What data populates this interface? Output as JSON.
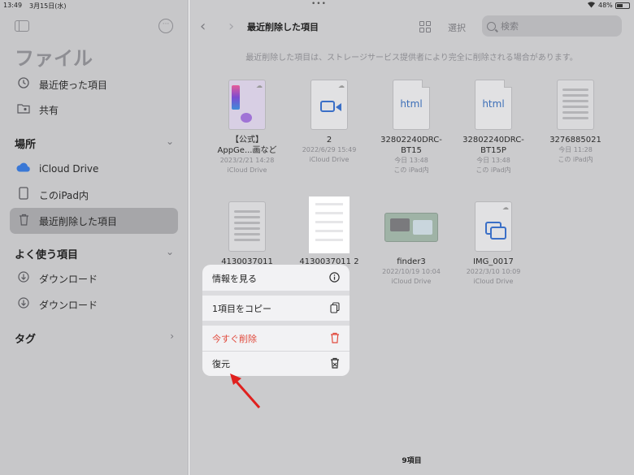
{
  "status": {
    "time": "13:49",
    "date": "3月15日(水)",
    "battery": "48%"
  },
  "sidebar": {
    "title": "ファイル",
    "items_top": [
      {
        "label": "最近使った項目",
        "icon": "clock-icon"
      },
      {
        "label": "共有",
        "icon": "shared-folder-icon"
      }
    ],
    "sections": [
      {
        "title": "場所",
        "items": [
          {
            "label": "iCloud Drive",
            "icon": "cloud-icon"
          },
          {
            "label": "このiPad内",
            "icon": "ipad-icon"
          },
          {
            "label": "最近削除した項目",
            "icon": "trash-icon",
            "selected": true
          }
        ]
      },
      {
        "title": "よく使う項目",
        "items": [
          {
            "label": "ダウンロード",
            "icon": "download-icon"
          },
          {
            "label": "ダウンロード",
            "icon": "download-icon"
          }
        ]
      },
      {
        "title": "タグ",
        "items": []
      }
    ]
  },
  "header": {
    "title": "最近削除した項目",
    "select_label": "選択",
    "search_placeholder": "検索"
  },
  "notice": "最近削除した項目は、ストレージサービス提供者により完全に削除される場合があります。",
  "files": [
    {
      "name1": "【公式】",
      "name2": "AppGe...画など",
      "date": "2023/2/21 14:28",
      "loc": "iCloud Drive"
    },
    {
      "name1": "2",
      "name2": "",
      "date": "2022/6/29 15:49",
      "loc": "iCloud Drive"
    },
    {
      "name1": "32802240DRC-",
      "name2": "BT15",
      "date": "今日 13:48",
      "loc": "この iPad内"
    },
    {
      "name1": "32802240DRC-",
      "name2": "BT15P",
      "date": "今日 13:48",
      "loc": "この iPad内"
    },
    {
      "name1": "3276885021",
      "name2": "",
      "date": "今日 11:28",
      "loc": "この iPad内"
    },
    {
      "name1": "4130037011",
      "name2": "",
      "date": "",
      "loc": ""
    },
    {
      "name1": "4130037011 2",
      "name2": "",
      "date": "",
      "loc": ""
    },
    {
      "name1": "finder3",
      "name2": "",
      "date": "2022/10/19 10:04",
      "loc": "iCloud Drive"
    },
    {
      "name1": "IMG_0017",
      "name2": "",
      "date": "2022/3/10 10:09",
      "loc": "iCloud Drive"
    }
  ],
  "html_label": "html",
  "item_count": "9項目",
  "context_menu": {
    "info": "情報を見る",
    "copy": "1項目をコピー",
    "delete": "今すぐ削除",
    "restore": "復元"
  },
  "colors": {
    "accent": "#3a6fc7",
    "destructive": "#e14a3c",
    "arrow": "#e0201e"
  }
}
